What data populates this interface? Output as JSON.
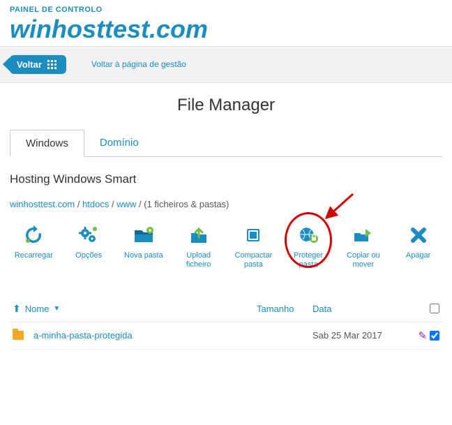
{
  "header": {
    "panel_label": "PAINEL DE CONTROLO",
    "domain": "winhosttest.com"
  },
  "nav": {
    "back_label": "Voltar",
    "manage_link": "Voltar à página de gestão"
  },
  "page": {
    "title": "File Manager"
  },
  "tabs": [
    {
      "label": "Windows",
      "active": true
    },
    {
      "label": "Domínio",
      "active": false
    }
  ],
  "section_title": "Hosting Windows Smart",
  "breadcrumb": {
    "parts": [
      "winhosttest.com",
      "htdocs",
      "www"
    ],
    "sep": " / ",
    "suffix": "(1 ficheiros & pastas)"
  },
  "toolbar": [
    {
      "id": "reload",
      "label": "Recarregar"
    },
    {
      "id": "options",
      "label": "Opções"
    },
    {
      "id": "newfolder",
      "label": "Nova pasta"
    },
    {
      "id": "upload",
      "label": "Upload ficheiro"
    },
    {
      "id": "compress",
      "label": "Compactar pasta"
    },
    {
      "id": "protect",
      "label": "Proteger pasta"
    },
    {
      "id": "copy",
      "label": "Copiar ou mover"
    },
    {
      "id": "delete",
      "label": "Apagar"
    }
  ],
  "columns": {
    "name": "Nome",
    "size": "Tamanho",
    "date": "Data"
  },
  "rows": [
    {
      "name": "a-minha-pasta-protegida",
      "size": "",
      "date": "Sab 25 Mar 2017",
      "checked": true
    }
  ]
}
